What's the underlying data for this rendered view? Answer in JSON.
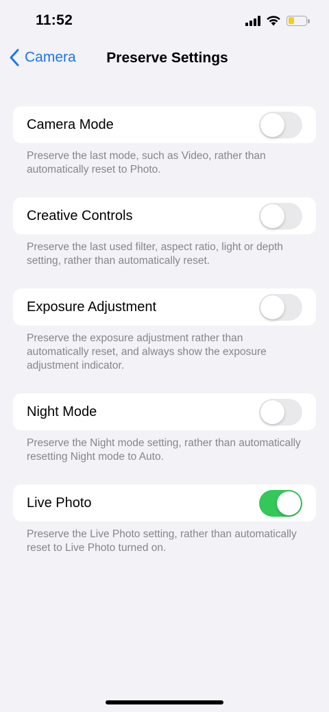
{
  "status_bar": {
    "time": "11:52",
    "battery_level": 0.35,
    "battery_color": "#f5cd1c"
  },
  "nav": {
    "back_label": "Camera",
    "title": "Preserve Settings"
  },
  "settings": [
    {
      "label": "Camera Mode",
      "on": false,
      "footer": "Preserve the last mode, such as Video, rather than automatically reset to Photo."
    },
    {
      "label": "Creative Controls",
      "on": false,
      "footer": "Preserve the last used filter, aspect ratio, light or depth setting, rather than automatically reset."
    },
    {
      "label": "Exposure Adjustment",
      "on": false,
      "footer": "Preserve the exposure adjustment rather than automatically reset, and always show the exposure adjustment indicator."
    },
    {
      "label": "Night Mode",
      "on": false,
      "footer": "Preserve the Night mode setting, rather than automatically resetting Night mode to Auto."
    },
    {
      "label": "Live Photo",
      "on": true,
      "footer": "Preserve the Live Photo setting, rather than automatically reset to Live Photo turned on."
    }
  ],
  "colors": {
    "accent": "#1c76e8",
    "toggle_on": "#34c759",
    "toggle_off": "#e9e9eb",
    "background": "#f2f2f7"
  }
}
